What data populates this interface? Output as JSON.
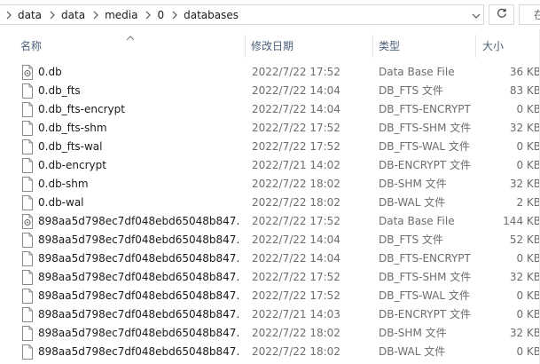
{
  "address": {
    "crumbs": [
      "data",
      "data",
      "media",
      "0",
      "databases"
    ],
    "search_partial": "在"
  },
  "columns": {
    "name": "名称",
    "date": "修改日期",
    "type": "类型",
    "size": "大小"
  },
  "files": [
    {
      "name": "0.db",
      "date": "2022/7/22 17:52",
      "type": "Data Base File",
      "size": "36 KB",
      "icon": "database-file-icon"
    },
    {
      "name": "0.db_fts",
      "date": "2022/7/22 14:04",
      "type": "DB_FTS 文件",
      "size": "83 KB",
      "icon": "file-icon"
    },
    {
      "name": "0.db_fts-encrypt",
      "date": "2022/7/22 14:04",
      "type": "DB_FTS-ENCRYPT",
      "size": "0 KB",
      "icon": "file-icon"
    },
    {
      "name": "0.db_fts-shm",
      "date": "2022/7/22 17:52",
      "type": "DB_FTS-SHM 文件",
      "size": "32 KB",
      "icon": "file-icon"
    },
    {
      "name": "0.db_fts-wal",
      "date": "2022/7/22 17:52",
      "type": "DB_FTS-WAL 文件",
      "size": "0 KB",
      "icon": "file-icon"
    },
    {
      "name": "0.db-encrypt",
      "date": "2022/7/21 14:02",
      "type": "DB-ENCRYPT 文件",
      "size": "0 KB",
      "icon": "file-icon"
    },
    {
      "name": "0.db-shm",
      "date": "2022/7/22 18:02",
      "type": "DB-SHM 文件",
      "size": "32 KB",
      "icon": "file-icon"
    },
    {
      "name": "0.db-wal",
      "date": "2022/7/22 18:02",
      "type": "DB-WAL 文件",
      "size": "2 KB",
      "icon": "file-icon"
    },
    {
      "name": "898aa5d798ec7df048ebd65048b847...",
      "date": "2022/7/22 17:52",
      "type": "Data Base File",
      "size": "144 KB",
      "icon": "database-file-icon"
    },
    {
      "name": "898aa5d798ec7df048ebd65048b847...",
      "date": "2022/7/22 14:04",
      "type": "DB_FTS 文件",
      "size": "52 KB",
      "icon": "file-icon"
    },
    {
      "name": "898aa5d798ec7df048ebd65048b847...",
      "date": "2022/7/22 14:04",
      "type": "DB_FTS-ENCRYPT",
      "size": "0 KB",
      "icon": "file-icon"
    },
    {
      "name": "898aa5d798ec7df048ebd65048b847...",
      "date": "2022/7/22 17:52",
      "type": "DB_FTS-SHM 文件",
      "size": "32 KB",
      "icon": "file-icon"
    },
    {
      "name": "898aa5d798ec7df048ebd65048b847...",
      "date": "2022/7/22 17:52",
      "type": "DB_FTS-WAL 文件",
      "size": "0 KB",
      "icon": "file-icon"
    },
    {
      "name": "898aa5d798ec7df048ebd65048b847...",
      "date": "2022/7/21 14:03",
      "type": "DB-ENCRYPT 文件",
      "size": "0 KB",
      "icon": "file-icon"
    },
    {
      "name": "898aa5d798ec7df048ebd65048b847...",
      "date": "2022/7/22 18:02",
      "type": "DB-SHM 文件",
      "size": "32 KB",
      "icon": "file-icon"
    },
    {
      "name": "898aa5d798ec7df048ebd65048b847...",
      "date": "2022/7/22 18:02",
      "type": "DB-WAL 文件",
      "size": "0 KB",
      "icon": "file-icon"
    }
  ]
}
